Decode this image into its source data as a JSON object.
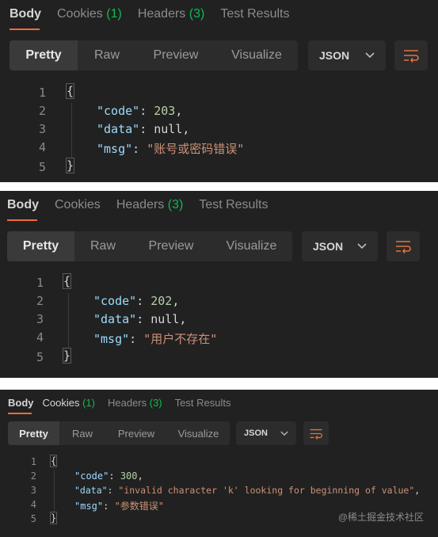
{
  "panels": [
    {
      "tabs": [
        {
          "label": "Body",
          "count": ""
        },
        {
          "label": "Cookies",
          "count": "(1)"
        },
        {
          "label": "Headers",
          "count": "(3)"
        },
        {
          "label": "Test Results",
          "count": ""
        }
      ],
      "view_modes": [
        "Pretty",
        "Raw",
        "Preview",
        "Visualize"
      ],
      "format": "JSON",
      "lines": [
        {
          "n": "1",
          "open": "{"
        },
        {
          "n": "2",
          "key": "\"code\"",
          "colon": ": ",
          "val": "203",
          "vtype": "num",
          "comma": ","
        },
        {
          "n": "3",
          "key": "\"data\"",
          "colon": ": ",
          "val": "null",
          "vtype": "kw",
          "comma": ","
        },
        {
          "n": "4",
          "key": "\"msg\"",
          "colon": ": ",
          "val": "\"账号或密码错误\"",
          "vtype": "str",
          "comma": ""
        },
        {
          "n": "5",
          "open": "}"
        }
      ]
    },
    {
      "tabs": [
        {
          "label": "Body",
          "count": ""
        },
        {
          "label": "Cookies",
          "count": ""
        },
        {
          "label": "Headers",
          "count": "(3)"
        },
        {
          "label": "Test Results",
          "count": ""
        }
      ],
      "view_modes": [
        "Pretty",
        "Raw",
        "Preview",
        "Visualize"
      ],
      "format": "JSON",
      "lines": [
        {
          "n": "1",
          "open": "{"
        },
        {
          "n": "2",
          "key": "\"code\"",
          "colon": ": ",
          "val": "202",
          "vtype": "num",
          "comma": ","
        },
        {
          "n": "3",
          "key": "\"data\"",
          "colon": ": ",
          "val": "null",
          "vtype": "kw",
          "comma": ","
        },
        {
          "n": "4",
          "key": "\"msg\"",
          "colon": ": ",
          "val": "\"用户不存在\"",
          "vtype": "str",
          "comma": ""
        },
        {
          "n": "5",
          "open": "}"
        }
      ]
    },
    {
      "tabs": [
        {
          "label": "Body",
          "count": ""
        },
        {
          "label": "Cookies",
          "count": "(1)"
        },
        {
          "label": "Headers",
          "count": "(3)"
        },
        {
          "label": "Test Results",
          "count": ""
        }
      ],
      "view_modes": [
        "Pretty",
        "Raw",
        "Preview",
        "Visualize"
      ],
      "format": "JSON",
      "lines": [
        {
          "n": "1",
          "open": "{"
        },
        {
          "n": "2",
          "key": "\"code\"",
          "colon": ": ",
          "val": "300",
          "vtype": "num",
          "comma": ","
        },
        {
          "n": "3",
          "key": "\"data\"",
          "colon": ": ",
          "val": "\"invalid character 'k' looking for beginning of value\"",
          "vtype": "str",
          "comma": ","
        },
        {
          "n": "4",
          "key": "\"msg\"",
          "colon": ": ",
          "val": "\"参数错误\"",
          "vtype": "str",
          "comma": ""
        },
        {
          "n": "5",
          "open": "}"
        }
      ]
    }
  ],
  "watermark": "@稀土掘金技术社区",
  "icons": {
    "chevron": "chevron-down-icon",
    "wrap": "wrap-lines-icon"
  }
}
